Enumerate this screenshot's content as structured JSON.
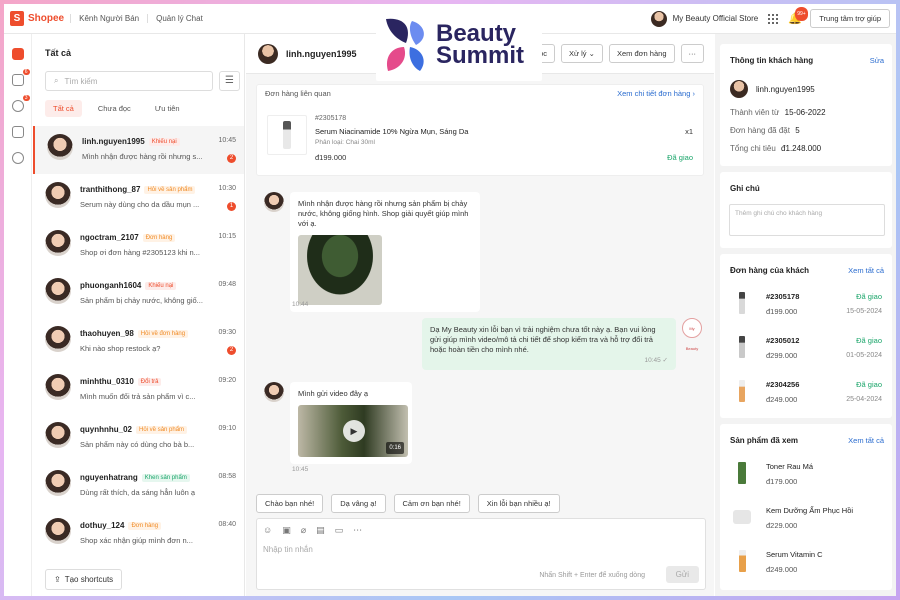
{
  "topbar": {
    "brand": "Shopee",
    "nav": [
      "Kênh Người Bán",
      "Quản lý Chat"
    ],
    "shop_name": "My Beauty Official Store",
    "notif_count": "99+",
    "help": "Trung tâm trợ giúp"
  },
  "logo": {
    "line1": "Beauty",
    "line2": "Summit"
  },
  "rail": {
    "badges": [
      "6",
      "3"
    ]
  },
  "conversations": {
    "title": "Tất cả",
    "search_placeholder": "Tìm kiếm",
    "filters": [
      "Tất cả",
      "Chưa đọc",
      "Ưu tiên"
    ],
    "items": [
      {
        "name": "linh.nguyen1995",
        "tag": "Khiếu nại",
        "tag_color": "red",
        "message": "Mình nhận được hàng rồi nhưng s...",
        "time": "10:45",
        "unread": "2"
      },
      {
        "name": "tranthithong_87",
        "tag": "Hỏi về sản phẩm",
        "tag_color": "orange",
        "message": "Serum này dùng cho da dầu mụn ...",
        "time": "10:30",
        "unread": "1"
      },
      {
        "name": "ngoctram_2107",
        "tag": "Đơn hàng",
        "tag_color": "orange",
        "message": "Shop ơi đơn hàng #2305123 khi n...",
        "time": "10:15",
        "unread": ""
      },
      {
        "name": "phuonganh1604",
        "tag": "Khiếu nại",
        "tag_color": "red",
        "message": "Sản phẩm bị chảy nước, không giố...",
        "time": "09:48",
        "unread": ""
      },
      {
        "name": "thaohuyen_98",
        "tag": "Hỏi về đơn hàng",
        "tag_color": "orange",
        "message": "Khi nào shop restock ạ?",
        "time": "09:30",
        "unread": "2"
      },
      {
        "name": "minhthu_0310",
        "tag": "Đổi trả",
        "tag_color": "red",
        "message": "Mình muốn đổi trả sản phẩm vì c...",
        "time": "09:20",
        "unread": ""
      },
      {
        "name": "quynhnhu_02",
        "tag": "Hỏi về sản phẩm",
        "tag_color": "orange",
        "message": "Sản phẩm này có dùng cho bà b...",
        "time": "09:10",
        "unread": ""
      },
      {
        "name": "nguyenhatrang",
        "tag": "Khen sản phẩm",
        "tag_color": "green",
        "message": "Dùng rất thích, da sáng hẳn luôn ạ",
        "time": "08:58",
        "unread": ""
      },
      {
        "name": "dothuy_124",
        "tag": "Đơn hàng",
        "tag_color": "orange",
        "message": "Shop xác nhận giúp mình đơn n...",
        "time": "08:40",
        "unread": ""
      }
    ],
    "shortcuts": "Tạo shortcuts"
  },
  "chat": {
    "name": "linh.nguyen1995",
    "header_buttons": [
      "ọc",
      "Xử lý",
      "Xem đơn hàng",
      "···"
    ],
    "order": {
      "title": "Đơn hàng liên quan",
      "link": "Xem chi tiết đơn hàng",
      "id": "#2305178",
      "product": "Serum Niacinamide 10% Ngừa Mụn, Sáng Da",
      "variant": "Phân loại: Chai 30ml",
      "price": "đ199.000",
      "qty": "x1",
      "status": "Đã giao"
    },
    "messages": [
      {
        "text": "Mình nhận được hàng rồi nhưng sản phẩm bị chảy nước, không giống hình. Shop giải quyết giúp mình với ạ.",
        "time": "10:44"
      },
      {
        "text": "Dạ My Beauty xin lỗi bạn vì trải nghiệm chưa tốt này ạ. Bạn vui lòng gửi giúp mình video/mô tả chi tiết để shop kiểm tra và hỗ trợ đổi trả hoặc hoàn tiền cho mình nhé.",
        "time": "10:45 ✓"
      },
      {
        "text": "Mình gửi video đây ạ",
        "time": "10:45",
        "video_duration": "0:16"
      }
    ],
    "shop_avatar": "My Beauty",
    "quick_replies": [
      "Chào bạn nhé!",
      "Dạ vâng ạ!",
      "Cảm ơn bạn nhé!",
      "Xin lỗi bạn nhiều ạ!"
    ],
    "placeholder": "Nhập tin nhắn",
    "hint": "Nhấn Shift + Enter để xuống dòng",
    "send": "Gửi"
  },
  "customer": {
    "title": "Thông tin khách hàng",
    "edit": "Sửa",
    "name": "linh.nguyen1995",
    "member_label": "Thành viên từ",
    "member_since": "15-06-2022",
    "orders_label": "Đơn hàng đã đặt",
    "orders": "5",
    "spend_label": "Tổng chi tiêu",
    "spend": "đ1.248.000"
  },
  "notes": {
    "title": "Ghi chú",
    "placeholder": "Thêm ghi chú cho khách hàng"
  },
  "orders": {
    "title": "Đơn hàng của khách",
    "link": "Xem tất cả",
    "items": [
      {
        "id": "#2305178",
        "price": "đ199.000",
        "status": "Đã giao",
        "date": "15-05-2024",
        "color": "#d9d9d9"
      },
      {
        "id": "#2305012",
        "price": "đ299.000",
        "status": "Đã giao",
        "date": "01-05-2024",
        "color": "#c9c9c9"
      },
      {
        "id": "#2304256",
        "price": "đ249.000",
        "status": "Đã giao",
        "date": "25-04-2024",
        "color": "#e8a560"
      }
    ]
  },
  "viewed": {
    "title": "Sản phẩm đã xem",
    "link": "Xem tất cả",
    "items": [
      {
        "name": "Toner Rau Má",
        "price": "đ179.000",
        "color": "#4a7a3a"
      },
      {
        "name": "Kem Dưỡng Ẩm Phục Hồi",
        "price": "đ229.000",
        "color": "#e6e6e6"
      },
      {
        "name": "Serum Vitamin C",
        "price": "đ249.000",
        "color": "#e8a04a"
      }
    ]
  }
}
